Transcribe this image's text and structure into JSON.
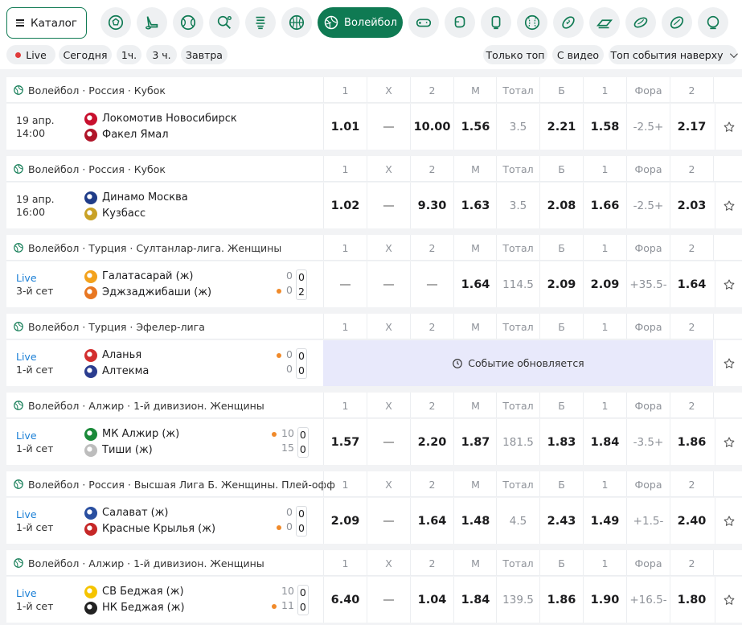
{
  "topbar": {
    "catalog_label": "Каталог",
    "active_sport_label": "Волейбол",
    "sports": [
      "football-icon",
      "hockey-icon",
      "tennis-icon",
      "table-tennis-icon",
      "basketball-stack-icon",
      "basketball-icon",
      "volleyball-icon",
      "esports-icon",
      "boxing-icon",
      "mma-icon",
      "baseball-icon",
      "american-football-icon",
      "formula1-icon",
      "rugby-icon",
      "cricket-icon",
      "more-icon"
    ],
    "accent": "#0f7a53"
  },
  "filters": {
    "live": "Live",
    "today": "Сегодня",
    "h1": "1ч.",
    "h3": "3 ч.",
    "tomorrow": "Завтра",
    "top_only": "Только топ",
    "with_video": "С видео",
    "sort": "Топ события наверху"
  },
  "columns": [
    "1",
    "X",
    "2",
    "М",
    "Тотал",
    "Б",
    "1",
    "Фора",
    "2"
  ],
  "updating_text": "Событие обновляется",
  "events": [
    {
      "league": "Волейбол · Россия · Кубок",
      "time1": "19 апр.",
      "time2": "14:00",
      "team1": "Локомотив Новосибирск",
      "team2": "Факел Ямал",
      "odds": [
        "1.01",
        "—",
        "10.00",
        "1.56",
        "3.5",
        "2.21",
        "1.58",
        "-2.5+",
        "2.17"
      ]
    },
    {
      "league": "Волейбол · Россия · Кубок",
      "time1": "19 апр.",
      "time2": "16:00",
      "team1": "Динамо Москва",
      "team2": "Кузбасс",
      "odds": [
        "1.02",
        "—",
        "9.30",
        "1.63",
        "3.5",
        "2.08",
        "1.66",
        "-2.5+",
        "2.03"
      ]
    },
    {
      "league": "Волейбол · Турция · Султанлар-лига. Женщины",
      "time1": "Live",
      "time2": "3-й сет",
      "team1": "Галатасарай (ж)",
      "team2": "Эджзаджибаши (ж)",
      "set_score": [
        "0",
        "0"
      ],
      "game_score": [
        "0",
        "2"
      ],
      "odds": [
        "—",
        "—",
        "—",
        "1.64",
        "114.5",
        "2.09",
        "2.09",
        "+35.5-",
        "1.64"
      ]
    },
    {
      "league": "Волейбол · Турция · Эфелер-лига",
      "time1": "Live",
      "time2": "1-й сет",
      "team1": "Аланья",
      "team2": "Алтекма",
      "set_score": [
        "0",
        "0"
      ],
      "game_score": [
        "0",
        "0"
      ]
    },
    {
      "league": "Волейбол · Алжир · 1-й дивизион. Женщины",
      "time1": "Live",
      "time2": "1-й сет",
      "team1": "МК Алжир (ж)",
      "team2": "Тиши (ж)",
      "set_score": [
        "10",
        "15"
      ],
      "game_score": [
        "0",
        "0"
      ],
      "odds": [
        "1.57",
        "—",
        "2.20",
        "1.87",
        "181.5",
        "1.83",
        "1.84",
        "-3.5+",
        "1.86"
      ]
    },
    {
      "league": "Волейбол · Россия · Высшая Лига Б. Женщины. Плей-офф",
      "time1": "Live",
      "time2": "1-й сет",
      "team1": "Салават (ж)",
      "team2": "Красные Крылья (ж)",
      "set_score": [
        "0",
        "0"
      ],
      "game_score": [
        "0",
        "0"
      ],
      "odds": [
        "2.09",
        "—",
        "1.64",
        "1.48",
        "4.5",
        "2.43",
        "1.49",
        "+1.5-",
        "2.40"
      ]
    },
    {
      "league": "Волейбол · Алжир · 1-й дивизион. Женщины",
      "time1": "Live",
      "time2": "1-й сет",
      "team1": "СВ Беджая (ж)",
      "team2": "НК Беджая (ж)",
      "set_score": [
        "10",
        "11"
      ],
      "game_score": [
        "0",
        "0"
      ],
      "odds": [
        "6.40",
        "—",
        "1.04",
        "1.84",
        "139.5",
        "1.86",
        "1.90",
        "+16.5-",
        "1.80"
      ]
    }
  ]
}
